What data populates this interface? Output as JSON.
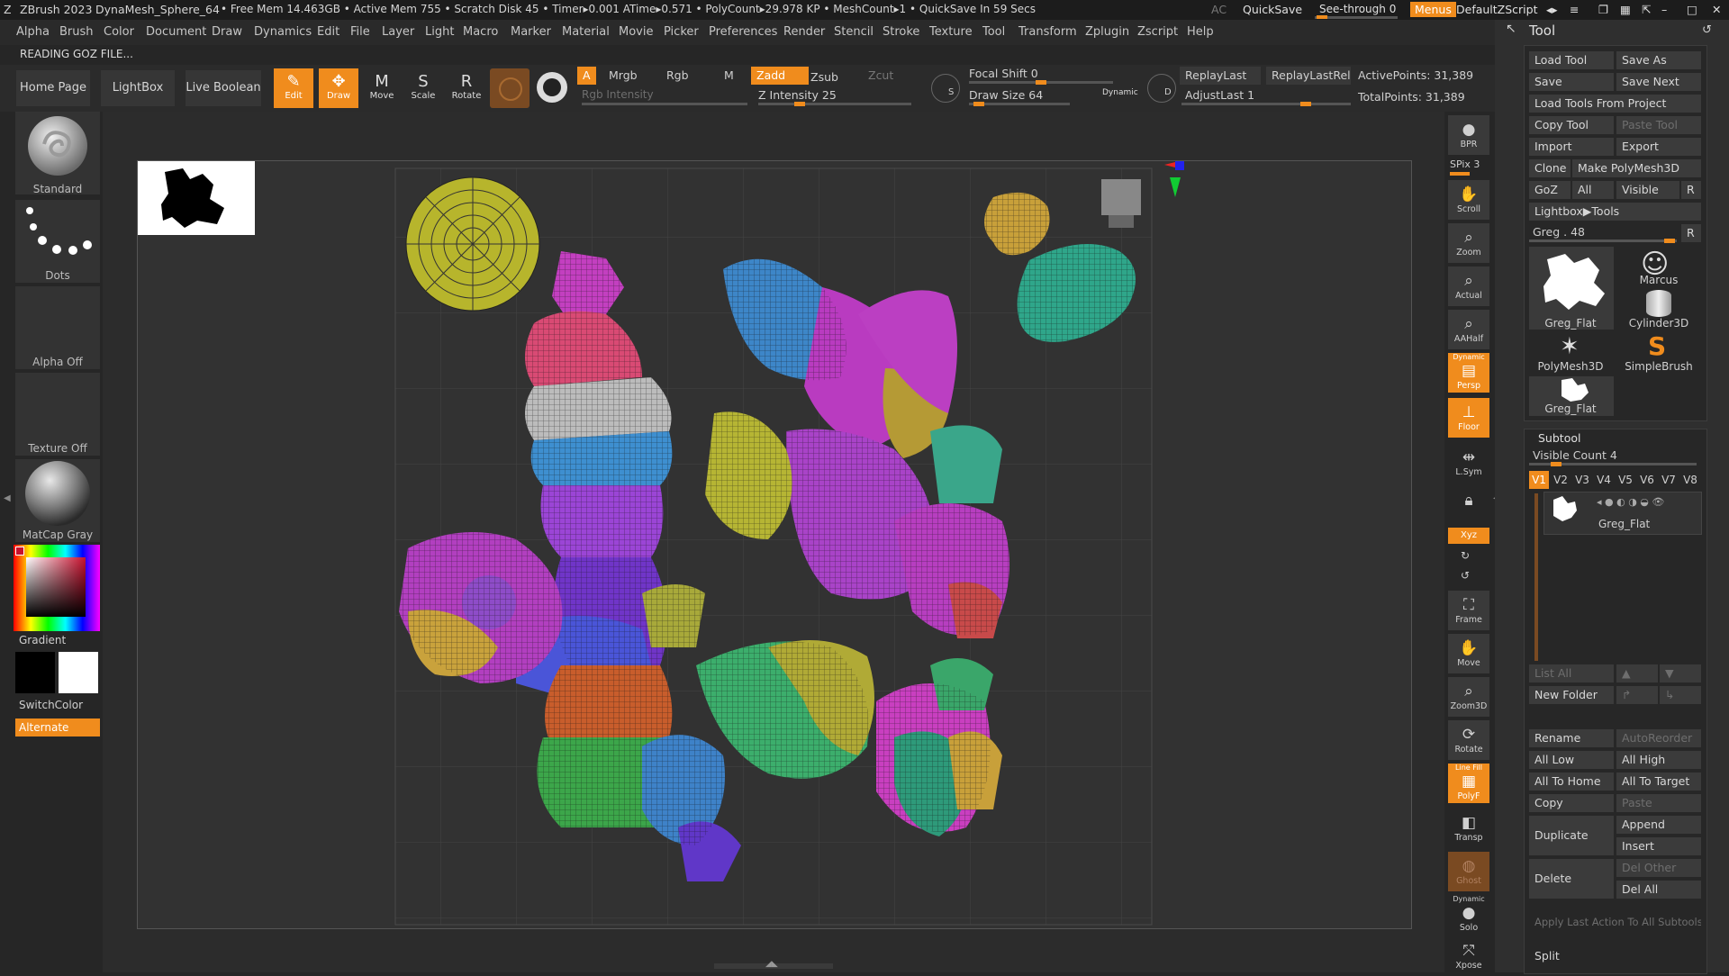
{
  "titlebar": {
    "app": "ZBrush 2023",
    "doc": "DynaMesh_Sphere_64",
    "stats": "• Free Mem 14.463GB • Active Mem 755 • Scratch Disk 45 • Timer▸0.001 ATime▸0.571 • PolyCount▸29.978 KP • MeshCount▸1 • QuickSave In 59 Secs",
    "ac": "AC",
    "quicksave": "QuickSave",
    "seethrough": "See-through",
    "seethrough_value": "0",
    "menus": "Menus",
    "script": "DefaultZScript"
  },
  "menubar": [
    "Alpha",
    "Brush",
    "Color",
    "Document",
    "Draw",
    "Dynamics",
    "Edit",
    "File",
    "Layer",
    "Light",
    "Macro",
    "Marker",
    "Material",
    "Movie",
    "Picker",
    "Preferences",
    "Render",
    "Stencil",
    "Stroke",
    "Texture",
    "Tool",
    "Transform",
    "Zplugin",
    "Zscript",
    "Help"
  ],
  "status_text": "READING GOZ FILE...",
  "shelf": {
    "tabs": [
      "Home Page",
      "LightBox",
      "Live Boolean"
    ],
    "tools": [
      {
        "label": "Edit",
        "icon": "✎",
        "on": true
      },
      {
        "label": "Draw",
        "icon": "✥",
        "on": true
      },
      {
        "label": "Move",
        "icon": "M",
        "on": false
      },
      {
        "label": "Scale",
        "icon": "S",
        "on": false
      },
      {
        "label": "Rotate",
        "icon": "R",
        "on": false
      }
    ],
    "a": "A",
    "mrgb": "Mrgb",
    "rgb": "Rgb",
    "m": "M",
    "zadd": "Zadd",
    "zsub": "Zsub",
    "zcut": "Zcut",
    "rgb_intensity": "Rgb Intensity",
    "z_intensity": "Z Intensity 25",
    "z_intensity_level": 0.25,
    "focal_shift": "Focal Shift 0",
    "focal_shift_level": 0.5,
    "draw_size": "Draw Size 64",
    "draw_size_level": 0.05,
    "dynamic": "Dynamic",
    "s": "S",
    "d": "D",
    "replay_last": "ReplayLast",
    "replay_last_rel": "ReplayLastRel",
    "adjust_last": "AdjustLast 1",
    "adjust_last_level": 0.75,
    "active_points": "ActivePoints: 31,389",
    "total_points": "TotalPoints: 31,389"
  },
  "leftshelf": {
    "standard": "Standard",
    "dots": "Dots",
    "alpha_off": "Alpha Off",
    "texture_off": "Texture Off",
    "matcap": "MatCap Gray",
    "gradient": "Gradient",
    "switchcolor": "SwitchColor",
    "alternate": "Alternate"
  },
  "rightshelf": {
    "bpr": "BPR",
    "spix": "SPix 3",
    "buttons": [
      "Scroll",
      "Zoom",
      "Actual",
      "AAHalf",
      "Persp",
      "Floor",
      "L.Sym",
      "",
      "Xyz",
      "",
      "",
      "Frame",
      "Move",
      "Zoom3D",
      "Rotate",
      "PolyF",
      "Transp",
      "Ghost",
      "Solo",
      "Xpose"
    ],
    "persp_tag": "Dynamic",
    "polyf_tag": "Line Fill",
    "solo_tag": "Dynamic"
  },
  "toolpal": {
    "title": "Tool",
    "buttons": [
      [
        "Load Tool",
        "Save As"
      ],
      [
        "Save",
        "Save Next"
      ],
      [
        "Load Tools From Project"
      ],
      [
        "Copy Tool",
        "Paste Tool"
      ],
      [
        "Import",
        "Export"
      ],
      [
        "Clone",
        "Make PolyMesh3D"
      ],
      [
        "GoZ",
        "All",
        "Visible",
        "R"
      ],
      [
        "Lightbox▶Tools"
      ]
    ],
    "greg_slider": "Greg . 48",
    "greg_r": "R",
    "tiles": [
      "Greg_Flat",
      "Marcus",
      "Cylinder3D",
      "PolyMesh3D",
      "SimpleBrush",
      "Greg_Flat"
    ],
    "subtool": {
      "title": "Subtool",
      "visible_count": "Visible Count 4",
      "tabs": [
        "V1",
        "V2",
        "V3",
        "V4",
        "V5",
        "V6",
        "V7",
        "V8"
      ],
      "item": "Greg_Flat",
      "list_all": "List All",
      "new_folder": "New Folder",
      "rename": "Rename",
      "autoreorder": "AutoReorder",
      "all_low": "All Low",
      "all_high": "All High",
      "all_to_home": "All To Home",
      "all_to_target": "All To Target",
      "copy": "Copy",
      "paste": "Paste",
      "duplicate": "Duplicate",
      "append": "Append",
      "insert": "Insert",
      "delete": "Delete",
      "del_other": "Del Other",
      "del_all": "Del All",
      "apply_last": "Apply Last Action To All Subtools",
      "split": "Split"
    }
  },
  "colors": {
    "accent": "#f08c1d",
    "bg": "#262626",
    "panel": "#2f2f2f",
    "canvas": "#323232"
  }
}
